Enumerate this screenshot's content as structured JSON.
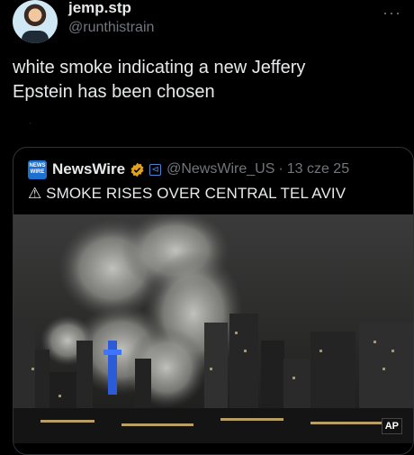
{
  "tweet": {
    "display_name": "jemp.stp",
    "handle": "@runthistrain",
    "more_icon": "more-horizontal-icon",
    "text": "white smoke indicating a new Jeffery\nEpstein has been chosen",
    "dot": "·"
  },
  "quote": {
    "logo_text_line1": "NEWS",
    "logo_text_line2": "WIRE",
    "display_name": "NewsWire",
    "verified_color": "#e0a321",
    "handle": "@NewsWire_US",
    "separator": "·",
    "date": "13 cze 25",
    "text": "⚠ SMOKE RISES OVER CENTRAL TEL AVIV",
    "image_watermark": "AP"
  },
  "colors": {
    "background": "#000000",
    "text": "#e7e9ea",
    "secondary": "#71767b",
    "border": "#2f3336",
    "newswire_blue": "#1d6fd0"
  }
}
